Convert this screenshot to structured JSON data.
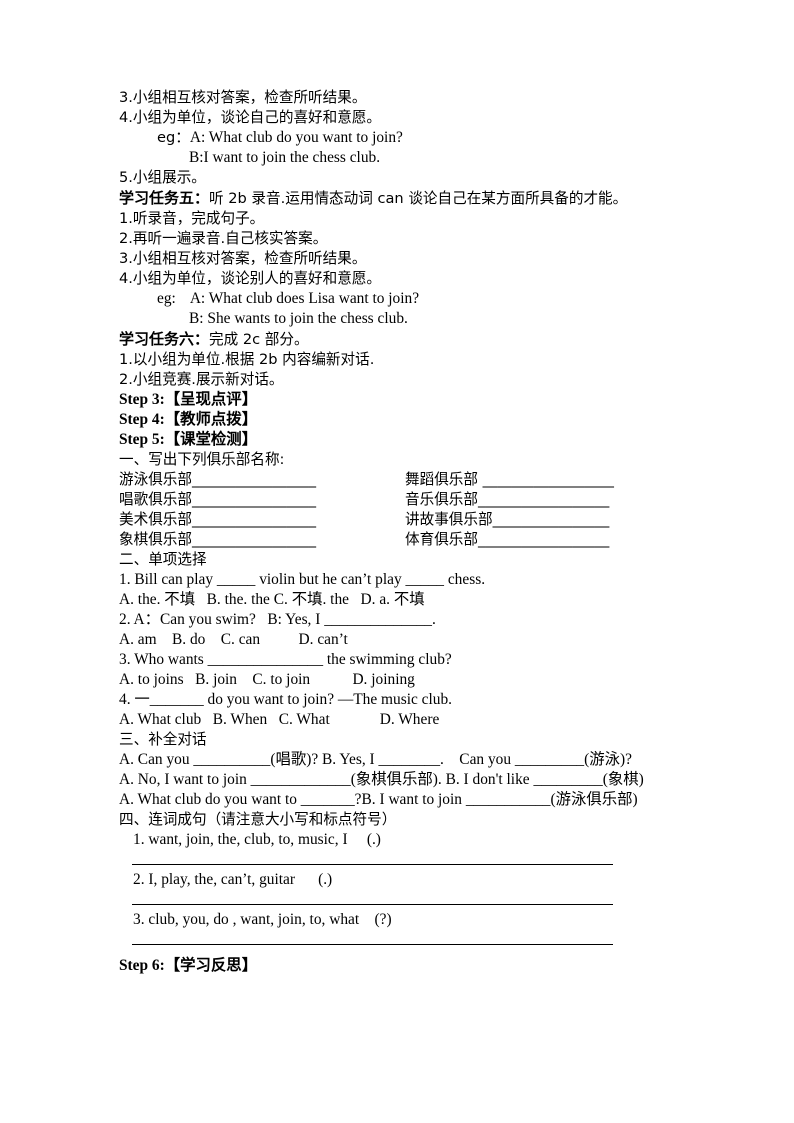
{
  "document": {
    "type": "lesson-plan-worksheet",
    "lines": {
      "t3": "3.小组相互核对答案，检查所听结果。",
      "t4": "4.小组为单位，谈论自己的喜好和意愿。",
      "eg1_label": "eg：",
      "eg1_a": "A: What club do you want to join?",
      "eg1_b": "B:I want to join the chess club.",
      "t5": "5.小组展示。",
      "task5_title": "学习任务五：",
      "task5_body": "听 2b 录音.运用情态动词 can 谈论自己在某方面所具备的才能。",
      "t5_1": "1.听录音，完成句子。",
      "t5_2": "2.再听一遍录音.自己核实答案。",
      "t5_3": "3.小组相互核对答案，检查所听结果。",
      "t5_4": "4.小组为单位，谈论别人的喜好和意愿。",
      "eg2_label": "eg:",
      "eg2_a": "A: What club does Lisa want to join?",
      "eg2_b": "B: She wants to join the chess club.",
      "task6_title": "学习任务六：",
      "task6_body": "完成 2c 部分。",
      "t6_1": "1.以小组为单位.根据 2b 内容编新对话.",
      "t6_2": "2.小组竞赛.展示新对话。",
      "step3": "Step 3:【呈现点评】",
      "step4": "Step 4:【教师点拨】",
      "step5": "Step 5:【课堂检测】",
      "step6": "Step 6:【学习反思】"
    },
    "section1": {
      "heading": "一、写出下列俱乐部名称:",
      "rows": [
        {
          "left_label": "游泳俱乐部",
          "left_blank": "_________________",
          "right_label": "舞蹈俱乐部 ",
          "right_blank": "__________________"
        },
        {
          "left_label": "唱歌俱乐部",
          "left_blank": "_________________",
          "right_label": "音乐俱乐部",
          "right_blank": "__________________"
        },
        {
          "left_label": "美术俱乐部",
          "left_blank": "_________________",
          "right_label": "讲故事俱乐部",
          "right_blank": "________________"
        },
        {
          "left_label": "象棋俱乐部",
          "left_blank": "_________________",
          "right_label": "体育俱乐部",
          "right_blank": "__________________"
        }
      ]
    },
    "section2": {
      "heading": "二、单项选择",
      "questions": [
        {
          "stem": "1. Bill can play _____ violin but he can’t play _____ chess.",
          "options": "A. the. 不填   B. the. the C. 不填. the   D. a. 不填"
        },
        {
          "stem": "2. A：Can you swim?   B: Yes, I ______________.",
          "options": "A. am    B. do    C. can          D. can’t"
        },
        {
          "stem": "3. Who wants _______________ the swimming club?",
          "options": "A. to joins   B. join    C. to join           D. joining"
        },
        {
          "stem": "4. 一_______ do you want to join? —The music club.",
          "options": "A. What club   B. When   C. What             D. Where"
        }
      ]
    },
    "section3": {
      "heading": "三、补全对话",
      "lines": [
        "A. Can you __________(唱歌)? B. Yes, I ________.    Can you _________(游泳)?",
        "A. No, I want to join _____________(象棋俱乐部). B. I don't like _________(象棋)",
        "A. What club do you want to _______?B. I want to join ___________(游泳俱乐部)"
      ]
    },
    "section4": {
      "heading": "四、连词成句（请注意大小写和标点符号）",
      "items": [
        "1. want, join, the, club, to, music, I     (.)",
        "2. I, play, the, can’t, guitar      (.)",
        "3. club, you, do , want, join, to, what    (?)"
      ]
    }
  }
}
